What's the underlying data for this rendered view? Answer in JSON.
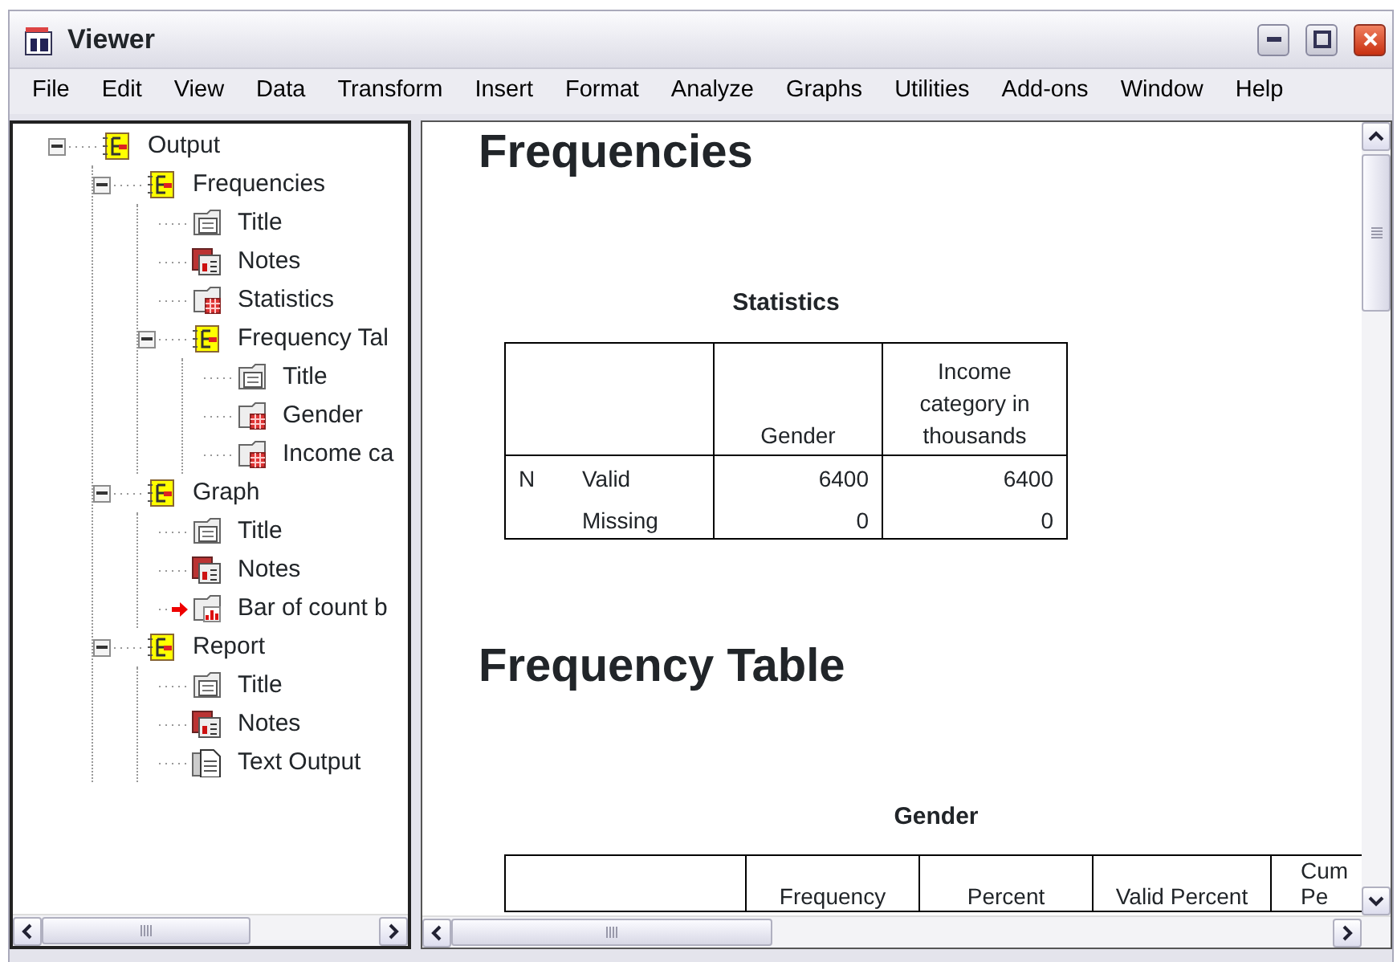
{
  "window": {
    "title": "Viewer"
  },
  "menu": [
    "File",
    "Edit",
    "View",
    "Data",
    "Transform",
    "Insert",
    "Format",
    "Analyze",
    "Graphs",
    "Utilities",
    "Add-ons",
    "Window",
    "Help"
  ],
  "outline": [
    {
      "label": "Output",
      "kind": "folder",
      "expanded": true,
      "current": false,
      "children": [
        {
          "label": "Frequencies",
          "kind": "folder",
          "expanded": true,
          "current": false,
          "children": [
            {
              "label": "Title",
              "kind": "title",
              "current": false
            },
            {
              "label": "Notes",
              "kind": "notes",
              "current": false
            },
            {
              "label": "Statistics",
              "kind": "table",
              "current": false
            },
            {
              "label": "Frequency Tal",
              "kind": "folder",
              "expanded": true,
              "current": false,
              "children": [
                {
                  "label": "Title",
                  "kind": "title",
                  "current": false
                },
                {
                  "label": "Gender",
                  "kind": "table",
                  "current": false
                },
                {
                  "label": "Income ca",
                  "kind": "table",
                  "current": false
                }
              ]
            }
          ]
        },
        {
          "label": "Graph",
          "kind": "folder",
          "expanded": true,
          "current": false,
          "children": [
            {
              "label": "Title",
              "kind": "title",
              "current": false
            },
            {
              "label": "Notes",
              "kind": "notes",
              "current": false
            },
            {
              "label": "Bar of count b",
              "kind": "chart",
              "current": true
            }
          ]
        },
        {
          "label": "Report",
          "kind": "folder",
          "expanded": true,
          "current": false,
          "children": [
            {
              "label": "Title",
              "kind": "title",
              "current": false
            },
            {
              "label": "Notes",
              "kind": "notes",
              "current": false
            },
            {
              "label": "Text Output",
              "kind": "text",
              "current": false
            }
          ]
        }
      ]
    }
  ],
  "content": [
    {
      "kind": "heading",
      "text": "Frequencies"
    },
    {
      "kind": "table",
      "title": "Statistics",
      "columns": [
        "",
        "",
        "Gender",
        "Income category in thousands"
      ],
      "rows": [
        [
          "N",
          "Valid",
          "6400",
          "6400"
        ],
        [
          "",
          "Missing",
          "0",
          "0"
        ]
      ]
    },
    {
      "kind": "heading",
      "text": "Frequency Table"
    },
    {
      "kind": "table",
      "title": "Gender",
      "columns": [
        "",
        "Frequency",
        "Percent",
        "Valid Percent",
        "Cum Pe"
      ]
    }
  ]
}
